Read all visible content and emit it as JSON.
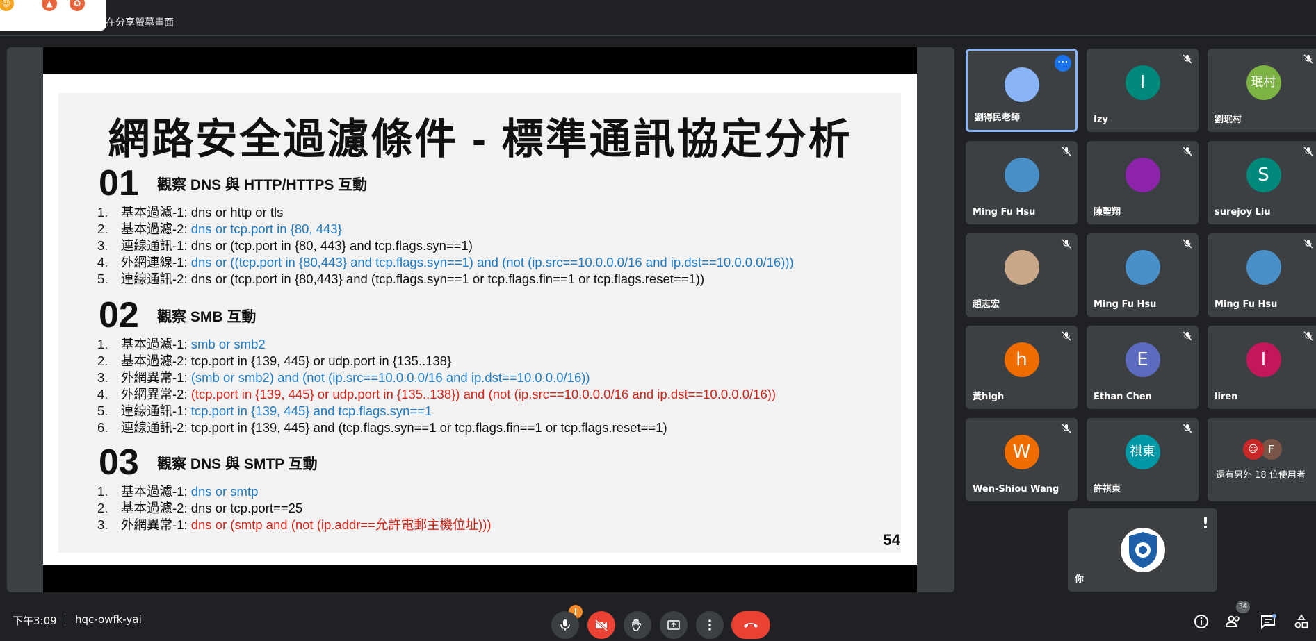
{
  "topbar": {
    "share_text": "在分享螢幕畫面"
  },
  "slide": {
    "title": "網路安全過濾條件 - 標準通訊協定分析",
    "page_number": "54",
    "sections": [
      {
        "number": "01",
        "heading": "觀察 DNS 與 HTTP/HTTPS 互動",
        "items": [
          {
            "num": "1.",
            "label": "基本過濾-1: ",
            "filter": "dns or http or tls",
            "color": "#111111"
          },
          {
            "num": "2.",
            "label": "基本過濾-2: ",
            "filter": "dns or tcp.port in {80, 443}",
            "color": "#1f7bc4"
          },
          {
            "num": "3.",
            "label": "連線通訊-1: ",
            "filter": "dns or (tcp.port in {80, 443} and tcp.flags.syn==1)",
            "color": "#111111"
          },
          {
            "num": "4.",
            "label": "外網連線-1: ",
            "filter": "dns or ((tcp.port in {80,443} and tcp.flags.syn==1) and (not (ip.src==10.0.0.0/16 and ip.dst==10.0.0.0/16)))",
            "color": "#1f7bc4"
          },
          {
            "num": "5.",
            "label": "連線通訊-2: ",
            "filter": "dns or (tcp.port in {80,443} and (tcp.flags.syn==1 or tcp.flags.fin==1 or tcp.flags.reset==1))",
            "color": "#111111"
          }
        ]
      },
      {
        "number": "02",
        "heading": "觀察 SMB 互動",
        "items": [
          {
            "num": "1.",
            "label": "基本過濾-1: ",
            "filter": "smb or smb2",
            "color": "#1f7bc4"
          },
          {
            "num": "2.",
            "label": "基本過濾-2: ",
            "filter": "tcp.port in {139, 445} or udp.port in {135..138}",
            "color": "#111111"
          },
          {
            "num": "3.",
            "label": "外網異常-1: ",
            "filter": "(smb or smb2) and (not (ip.src==10.0.0.0/16 and ip.dst==10.0.0.0/16))",
            "color": "#1f7bc4"
          },
          {
            "num": "4.",
            "label": "外網異常-2: ",
            "filter": "(tcp.port in {139, 445} or udp.port in {135..138}) and (not (ip.src==10.0.0.0/16 and ip.dst==10.0.0.0/16))",
            "color": "#d1261b"
          },
          {
            "num": "5.",
            "label": "連線通訊-1: ",
            "filter": "tcp.port in {139, 445} and tcp.flags.syn==1",
            "color": "#1f7bc4"
          },
          {
            "num": "6.",
            "label": "連線通訊-2: ",
            "filter": "tcp.port in {139, 445} and (tcp.flags.syn==1 or tcp.flags.fin==1 or tcp.flags.reset==1)",
            "color": "#111111"
          }
        ]
      },
      {
        "number": "03",
        "heading": "觀察 DNS 與 SMTP 互動",
        "items": [
          {
            "num": "1.",
            "label": "基本過濾-1: ",
            "filter": "dns or smtp",
            "color": "#1f7bc4"
          },
          {
            "num": "2.",
            "label": "基本過濾-2: ",
            "filter": "dns or tcp.port==25",
            "color": "#111111"
          },
          {
            "num": "3.",
            "label": "外網異常-1: ",
            "filter": "dns or (smtp and (not (ip.addr==允許電郵主機位址)))",
            "color": "#d1261b"
          }
        ]
      }
    ]
  },
  "participants": [
    {
      "name": "劉得民老師",
      "avatar": "",
      "avatar_color": "#8ab4f8",
      "muted": false,
      "active": true
    },
    {
      "name": "Izy",
      "avatar": "I",
      "avatar_color": "#00897b",
      "muted": true
    },
    {
      "name": "劉珉村",
      "avatar": "珉村",
      "avatar_color": "#7cb342",
      "muted": true
    },
    {
      "name": "Ming Fu Hsu",
      "avatar": "",
      "avatar_color": "#4a90c8",
      "muted": true
    },
    {
      "name": "陳聖翔",
      "avatar": "",
      "avatar_color": "#8e24aa",
      "muted": true
    },
    {
      "name": "surejoy Liu",
      "avatar": "S",
      "avatar_color": "#00897b",
      "muted": true
    },
    {
      "name": "趙志宏",
      "avatar": "",
      "avatar_color": "#c8a888",
      "muted": true
    },
    {
      "name": "Ming Fu Hsu",
      "avatar": "",
      "avatar_color": "#4a90c8",
      "muted": true
    },
    {
      "name": "Ming Fu Hsu",
      "avatar": "",
      "avatar_color": "#4a90c8",
      "muted": true
    },
    {
      "name": "黃high",
      "avatar": "h",
      "avatar_color": "#ef6c00",
      "muted": true
    },
    {
      "name": "Ethan Chen",
      "avatar": "E",
      "avatar_color": "#5c6bc0",
      "muted": true
    },
    {
      "name": "liren",
      "avatar": "I",
      "avatar_color": "#c2185b",
      "muted": true
    },
    {
      "name": "Wen-Shiou Wang",
      "avatar": "W",
      "avatar_color": "#ef6c00",
      "muted": true
    },
    {
      "name": "許祺東",
      "avatar": "祺東",
      "avatar_color": "#0097a7",
      "muted": true
    },
    {
      "name": "還有另外 18 位使用者",
      "avatar": "F",
      "avatar_color": "#795548",
      "muted": false,
      "others": true
    }
  ],
  "self_tile": {
    "name": "你"
  },
  "bottombar": {
    "time": "下午3:09",
    "meeting_code": "hqc-owfk-yai",
    "alert_badge": "!",
    "people_count": "34"
  },
  "colors": {
    "accent": "#8ab4f8",
    "end_call": "#ea4335",
    "blue_text": "#1f7bc4",
    "red_text": "#d1261b"
  }
}
